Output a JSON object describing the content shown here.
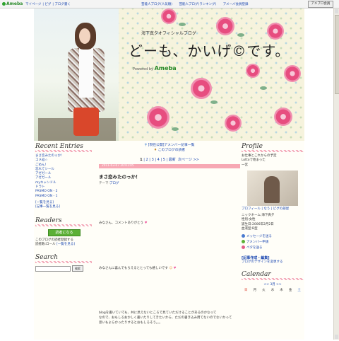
{
  "topbar": {
    "logo": "Ameba",
    "nav": [
      "マイページ",
      "ピグ",
      "ブログ書く"
    ],
    "tools": [
      "芸能人ブログ(人気順)",
      "芸能人ブログ(ランキング)",
      "アメーバ会員登録"
    ],
    "login": "アメブロ会員"
  },
  "header": {
    "subtitle": "海下真夕オフィシャルブログ",
    "title": "どーも、かいげ©です。",
    "powered_by": "Powered by",
    "powered_brand": "Ameba"
  },
  "left": {
    "recent_heading": "Recent Entries",
    "recent_items": [
      "まさ恋みたのっか!",
      "コメ返☆",
      "ごめん！",
      "忘れてシール",
      "アゼガール",
      "アゼガール",
      "myキャンドル",
      "ドラト",
      "PASMO ON - 2",
      "PASMO ON - 1"
    ],
    "recent_links": [
      "[一覧を見る]",
      "[記事一覧を見る]"
    ],
    "readers_heading": "Readers",
    "readers_button": "読者になる",
    "readers_text": "このブログの読者登録する",
    "readers_count": "読者数:ロール",
    "readers_link": "[一覧を見る]",
    "search_heading": "Search",
    "search_button": "検索"
  },
  "center": {
    "notice_link": "[現在公開]アメンバー記事一覧",
    "theme_link": "このブログの読者",
    "pager_current": "1",
    "pager_pages": [
      "2",
      "3",
      "4",
      "5"
    ],
    "pager_last": "最新",
    "pager_next": "次ページ >>",
    "date": "2011-03-07 20:01:05",
    "entry_title": "まさ恋みたのっか！",
    "theme_label": "テーマ:",
    "theme_value": "ブログ",
    "p1": "みなさん、コメントありがとう",
    "p2": "みなさんに喜んでもらえるととっても嬉しいです",
    "p3": "blogを書いていても、共に見えないところで見ていただけることがあるのかなって",
    "p4": "なので、おもしろおかしく書いたりしてきたいから、ただの書き込み用てないのでないかって",
    "p5": "思いもよらかったりするとおもしろそう。。。"
  },
  "right": {
    "profile_heading": "Profile",
    "profile_lines": [
      "お仕事とこれからの予定",
      "Lottoで始まった",
      "一宮"
    ],
    "profile_links": [
      "プロフィール",
      "なう",
      "ピグの部屋"
    ],
    "nickname": "ニックネーム:海下真夕",
    "gender": "性別:女性",
    "birthday": "誕生日:2006年2月2日",
    "bloodtype": "血液型:B型",
    "actions": [
      "メッセージを送る",
      "アメンバー申請",
      "ペタを送る"
    ],
    "ad_title": "[記事作成・編集]",
    "ad_sub": "ブログのデザインを変更する",
    "calendar_heading": "Calendar",
    "calendar_month": "<< 3月 >>",
    "calendar_days": [
      "日",
      "月",
      "火",
      "水",
      "木",
      "金",
      "土"
    ]
  },
  "colors": {
    "accent_pink": "#f7a8b4",
    "readers_green": "#5cb037",
    "link_blue": "#1a46b0"
  }
}
